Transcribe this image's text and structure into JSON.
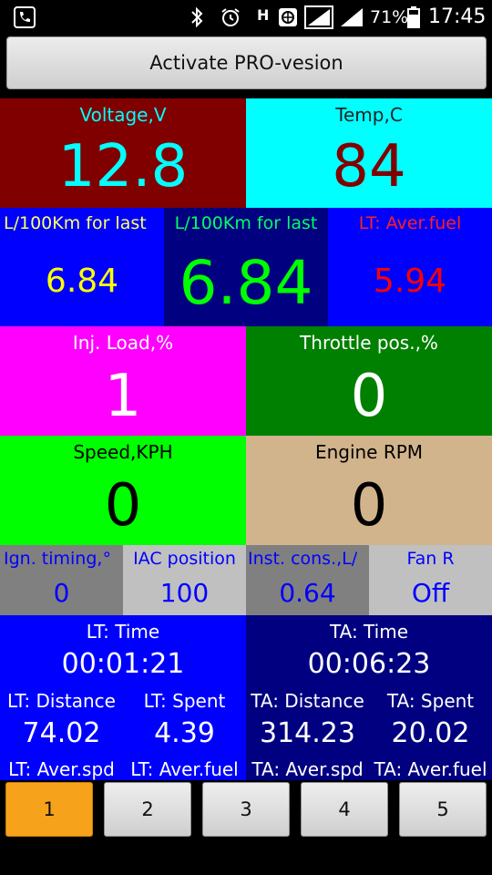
{
  "status_bar": {
    "battery": "71%",
    "time": "17:45",
    "network_h": "H",
    "icons": [
      "phone-icon",
      "bluetooth-icon",
      "alarm-icon",
      "network-h-icon",
      "globe-icon",
      "signal-icon",
      "signal-icon",
      "battery-icon"
    ]
  },
  "pro_button": {
    "label": "Activate PRO-vesion"
  },
  "row1": {
    "voltage": {
      "label": "Voltage,V",
      "value": "12.8"
    },
    "temp": {
      "label": "Temp,C",
      "value": "84"
    }
  },
  "row2": {
    "fuel_last_a": {
      "label": "L/100Km for last",
      "value": "6.84"
    },
    "fuel_last_b": {
      "label": "L/100Km for last",
      "value": "6.84"
    },
    "lt_aver_fuel": {
      "label": "LT: Aver.fuel",
      "value": "5.94"
    }
  },
  "row3": {
    "inj_load": {
      "label": "Inj. Load,%",
      "value": "1"
    },
    "throttle": {
      "label": "Throttle pos.,%",
      "value": "0"
    }
  },
  "row4": {
    "speed": {
      "label": "Speed,KPH",
      "value": "0"
    },
    "rpm": {
      "label": "Engine RPM",
      "value": "0"
    }
  },
  "row5": {
    "ign_timing": {
      "label": "Ign. timing,°",
      "value": "0"
    },
    "iac": {
      "label": "IAC position",
      "value": "100"
    },
    "inst_cons": {
      "label": "Inst. cons.,L/",
      "value": "0.64"
    },
    "fan": {
      "label": "Fan R",
      "value": "Off"
    }
  },
  "trip_lt": {
    "time_label": "LT: Time",
    "time": "00:01:21",
    "distance_label": "LT: Distance",
    "distance": "74.02",
    "spent_label": "LT: Spent",
    "spent": "4.39",
    "aver_spd_label": "LT: Aver.spd",
    "aver_fuel_label": "LT: Aver.fuel"
  },
  "trip_ta": {
    "time_label": "TA: Time",
    "time": "00:06:23",
    "distance_label": "TA: Distance",
    "distance": "314.23",
    "spent_label": "TA: Spent",
    "spent": "20.02",
    "aver_spd_label": "TA: Aver.spd",
    "aver_fuel_label": "TA: Aver.fuel"
  },
  "tabs": [
    {
      "label": "1",
      "active": true
    },
    {
      "label": "2",
      "active": false
    },
    {
      "label": "3",
      "active": false
    },
    {
      "label": "4",
      "active": false
    },
    {
      "label": "5",
      "active": false
    }
  ],
  "colors": {
    "voltage_bg": "#800000",
    "voltage_fg": "#00ffff",
    "temp_bg": "#00ffff",
    "temp_fg": "#800000",
    "fuel_bg": "#0000ff",
    "fuel_mid_bg": "#000080",
    "inj_bg": "#ff00ff",
    "throttle_bg": "#008000",
    "speed_bg": "#00ff00",
    "rpm_bg": "#d2b48c",
    "trip_lt_bg": "#0000ff",
    "trip_ta_bg": "#000080",
    "tab_active": "#f7a21b"
  }
}
